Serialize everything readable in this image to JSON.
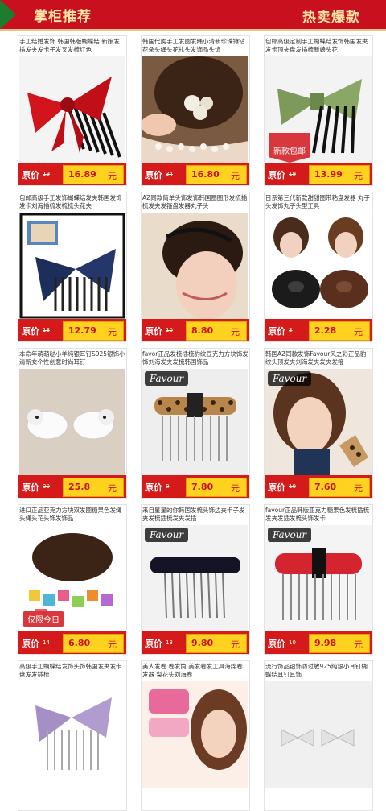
{
  "header": {
    "left_title": "掌柜推荐",
    "right_title": "热卖爆款",
    "accent": "#c8101e",
    "banner_text_color": "#ffe6a6"
  },
  "price_labels": {
    "label": "原价",
    "unit": "元"
  },
  "products": [
    {
      "desc": "手工结婚发饰 韩国韩版蝴蝶结 新娘发插发夹发卡子发叉发梳红色",
      "old": "19",
      "now": "16.89",
      "image": "red-bow-hair-comb"
    },
    {
      "desc": "韩国代购手工发圈发绳小清新珍珠镶钻花朵头绳头花扎头发饰品头饰",
      "old": "34",
      "now": "16.80",
      "image": "pearl-flower-hair-tie"
    },
    {
      "desc": "包邮高级定制手工蝴蝶结发饰韩国发夹发卡顶夹盘发插梳新娘头花",
      "old": "19",
      "now": "13.99",
      "image": "green-bow-hair-comb",
      "tag": "新款包邮"
    },
    {
      "desc": "包邮高级手工发饰蝴蝶结发夹韩国发饰发卡刘海插梳发梳梳头花夹",
      "old": "13",
      "now": "12.79",
      "image": "navy-bow-hair-comb"
    },
    {
      "desc": "AZ同款简单头饰发饰韩国圈圈形发梳插梳发夹发箍盘发器丸子头",
      "old": "10",
      "now": "8.80",
      "image": "hair-model-back"
    },
    {
      "desc": "日系第三代新款甜甜圈带粘盘发器 丸子头发饰丸子头型工具",
      "old": "3",
      "now": "2.28",
      "image": "bun-maker"
    },
    {
      "desc": "本命年萌萌哒小羊纯银耳钉S925银饰小清新女个性创意时尚耳钉",
      "old": "30",
      "now": "25.8",
      "image": "sheep-earrings"
    },
    {
      "desc": "favor正品发梳插梳豹纹豆克力方块饰发饰刘海发夹发梳韩国饰品",
      "old": "8",
      "now": "7.80",
      "image": "leopard-comb",
      "badge": "Favour"
    },
    {
      "desc": "韩国AZ同款发饰Favour风之彩正品豹纹头顶发夹刘海发夹发夹发箍",
      "old": "10",
      "now": "7.60",
      "image": "girl-leopard-clip",
      "badge": "Favour"
    },
    {
      "desc": "进口正品亚克力方块双发圈糖果色发绳头绳头花头饰发饰品",
      "old": "14",
      "now": "6.80",
      "image": "candy-hair-ties",
      "tag": "仅限今日"
    },
    {
      "desc": "来自星星的你韩国发梳头饰边夹卡子发夹发梳插梳发夹发插",
      "old": "13",
      "now": "9.80",
      "image": "black-hair-comb",
      "badge": "Favour"
    },
    {
      "desc": "favour正品韩版亚克力糖果色发梳插梳发夹发插发梳头饰发卡",
      "old": "10",
      "now": "9.98",
      "image": "red-hair-comb",
      "badge": "Favour"
    },
    {
      "desc": "高级手工蝴蝶结发饰头饰韩国发夹发卡盘发发插梳",
      "old": "",
      "now": "",
      "image": "lavender-bow-comb"
    },
    {
      "desc": "美人发卷 卷发筒 美发卷发工具海绵卷发器 梨花头刘海卷",
      "old": "",
      "now": "",
      "image": "hair-rollers"
    },
    {
      "desc": "流行饰品银饰防过敏925纯银小耳钉蝴蝶结耳钉耳饰",
      "old": "",
      "now": "",
      "image": "bow-earrings"
    }
  ],
  "colors": {
    "price_bar": "#d41a1a",
    "price_box": "#ffd21f",
    "price_text": "#c81313"
  }
}
